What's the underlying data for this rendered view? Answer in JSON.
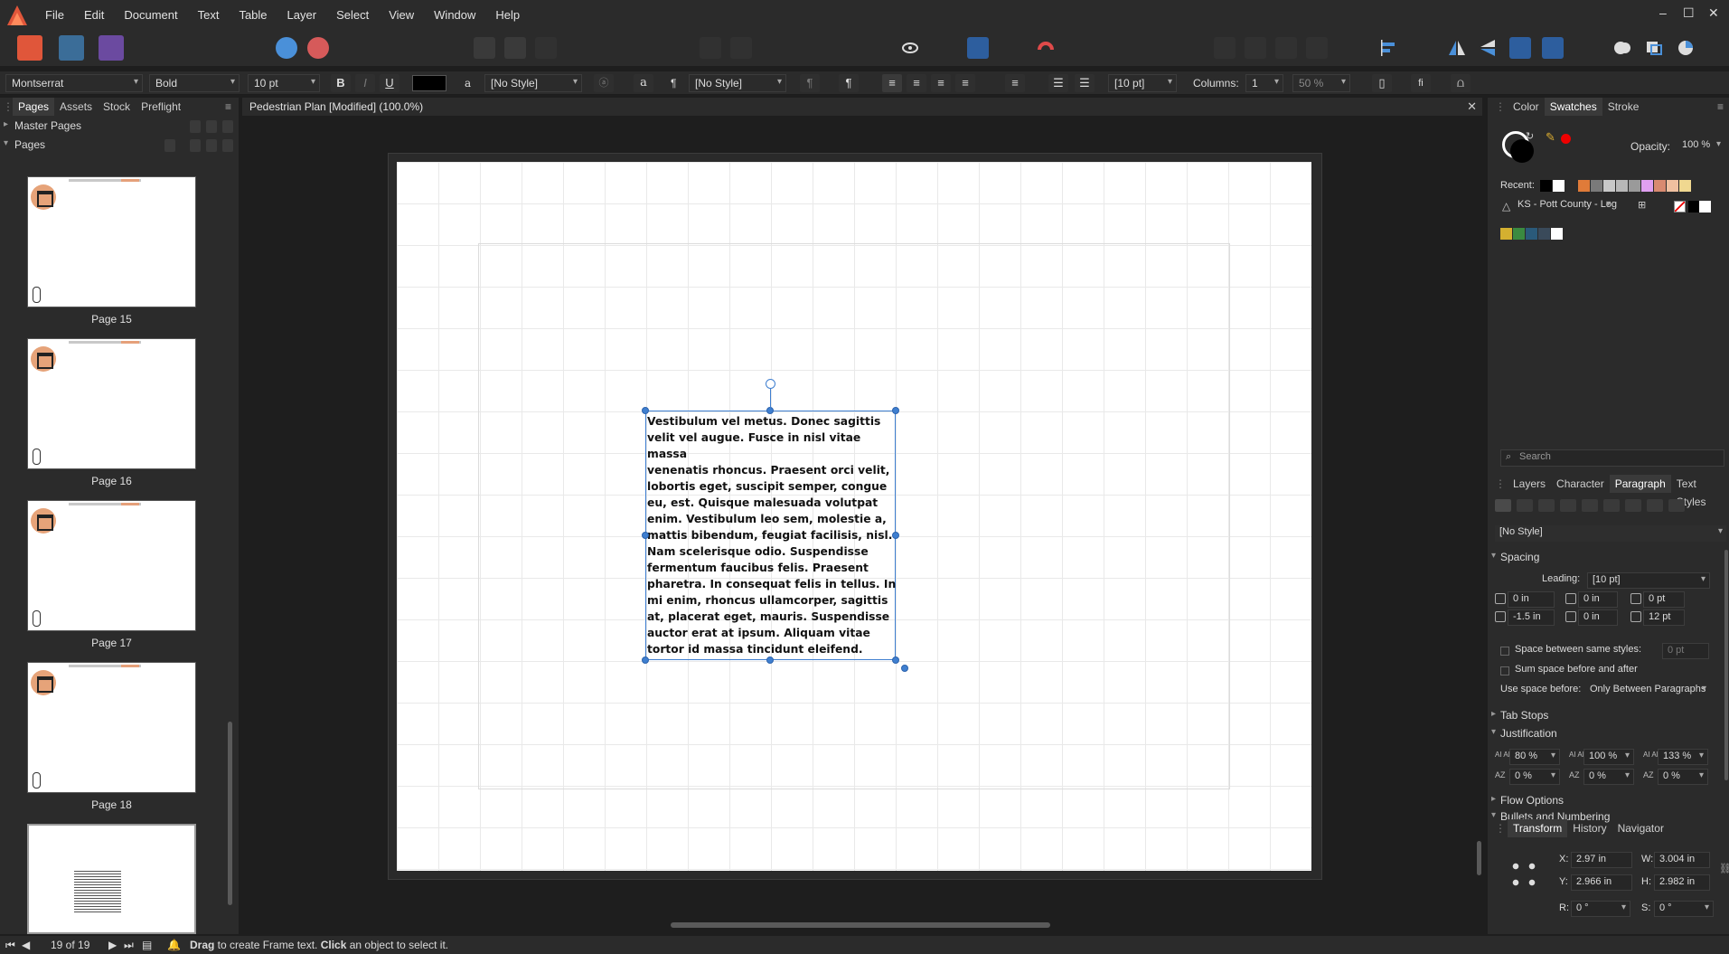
{
  "menu": [
    "File",
    "Edit",
    "Document",
    "Text",
    "Table",
    "Layer",
    "Select",
    "View",
    "Window",
    "Help"
  ],
  "window_controls": {
    "minimize": "–",
    "maximize": "☐",
    "close": "✕"
  },
  "context_bar": {
    "font_family": "Montserrat",
    "font_style": "Bold",
    "font_size": "10 pt",
    "bold": "B",
    "italic": "I",
    "underline": "U",
    "char_style": "[No Style]",
    "para_style": "[No Style]",
    "leading": "[10 pt]",
    "columns_label": "Columns:",
    "columns_value": "1",
    "zoom_value": "50 %",
    "glyph_a": "a",
    "pilcrow": "¶"
  },
  "left_panel": {
    "tabs": [
      "Pages",
      "Assets",
      "Stock",
      "Preflight"
    ],
    "master_pages": "Master Pages",
    "pages": "Pages",
    "page_labels": [
      "Page 15",
      "Page 16",
      "Page 17",
      "Page 18"
    ]
  },
  "document": {
    "tab_title": "Pedestrian Plan [Modified] (100.0%)",
    "close": "✕",
    "frame_text": "Vestibulum vel metus. Donec sagittis\nvelit vel augue. Fusce in nisl vitae massa\nvenenatis rhoncus. Praesent orci velit,\nlobortis eget, suscipit semper, congue\neu, est. Quisque malesuada volutpat\nenim. Vestibulum leo sem, molestie a,\nmattis bibendum, feugiat facilisis, nisl.\nNam scelerisque odio. Suspendisse\nfermentum faucibus felis. Praesent\npharetra. In consequat felis in tellus. In\nmi enim, rhoncus ullamcorper, sagittis\nat, placerat eget, mauris. Suspendisse\nauctor erat at ipsum. Aliquam vitae\ntortor id massa tincidunt eleifend."
  },
  "right_panel": {
    "top_tabs": [
      "Color",
      "Swatches",
      "Stroke"
    ],
    "opacity_label": "Opacity:",
    "opacity_value": "100 %",
    "recent_label": "Recent:",
    "palette_name": "KS - Pott County - Log",
    "recent_colors": [
      "#000000",
      "#ffffff",
      "#2b2b2b",
      "#e07b39",
      "#7a7a7a",
      "#c8c8c8",
      "#b8b8b8",
      "#9a9a9a",
      "#e0a0f0",
      "#d88a70",
      "#f0c0a0",
      "#f0d890"
    ],
    "palette_colors": [
      "#d4b030",
      "#3a8a40",
      "#2a5a7a",
      "#3a4a5a",
      "#ffffff"
    ],
    "search_placeholder": "Search",
    "mid_tabs": [
      "Layers",
      "Character",
      "Paragraph",
      "Text Styles"
    ],
    "paragraph": {
      "style": "[No Style]",
      "spacing": "Spacing",
      "leading_label": "Leading:",
      "leading_value": "[10 pt]",
      "left_indent": "0 in",
      "right_indent": "0 in",
      "space_before": "0 pt",
      "first_line": "-1.5 in",
      "last_line": "0 in",
      "space_after": "12 pt",
      "space_same_label": "Space between same styles:",
      "space_same_value": "0 pt",
      "sum_space_label": "Sum space before and after",
      "use_space_label": "Use space before:",
      "use_space_value": "Only Between Paragraphs",
      "tab_stops": "Tab Stops",
      "justification": "Justification",
      "word_min": "80 %",
      "word_desired": "100 %",
      "word_max": "133 %",
      "letter_min": "0 %",
      "letter_desired": "0 %",
      "letter_max": "0 %",
      "flow_options": "Flow Options",
      "bullets": "Bullets and Numbering"
    },
    "bottom_tabs": [
      "Transform",
      "History",
      "Navigator"
    ],
    "transform": {
      "x_label": "X:",
      "x": "2.97 in",
      "w_label": "W:",
      "w": "3.004 in",
      "y_label": "Y:",
      "y": "2.966 in",
      "h_label": "H:",
      "h": "2.982 in",
      "r_label": "R:",
      "r": "0 °",
      "s_label": "S:",
      "s": "0 °"
    }
  },
  "status_bar": {
    "page_indicator": "19 of 19",
    "hint_bold_1": "Drag",
    "hint_1": " to create Frame text. ",
    "hint_bold_2": "Click",
    "hint_2": " an object to select it."
  }
}
